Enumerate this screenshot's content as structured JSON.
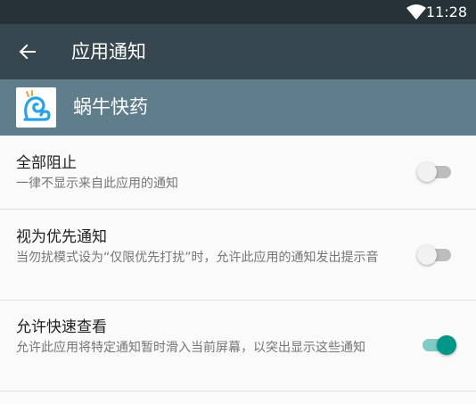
{
  "status_bar": {
    "time": "11:28",
    "wifi_icon": "wifi-icon"
  },
  "toolbar": {
    "back_icon": "arrow-back-icon",
    "title": "应用通知"
  },
  "app": {
    "name": "蜗牛快药",
    "icon": "snail-app-icon"
  },
  "settings": [
    {
      "label": "全部阻止",
      "description": "一律不显示来自此应用的通知",
      "enabled": false
    },
    {
      "label": "视为优先通知",
      "description": "当勿扰模式设为“仅限优先打扰”时，允许此应用的通知发出提示音",
      "enabled": false
    },
    {
      "label": "允许快速查看",
      "description": "允许此应用将特定通知暂时滑入当前屏幕，以突出显示这些通知",
      "enabled": true
    }
  ],
  "colors": {
    "status_bar": "#263238",
    "toolbar": "#37474f",
    "app_header": "#607d8b",
    "switch_on": "#009688"
  }
}
